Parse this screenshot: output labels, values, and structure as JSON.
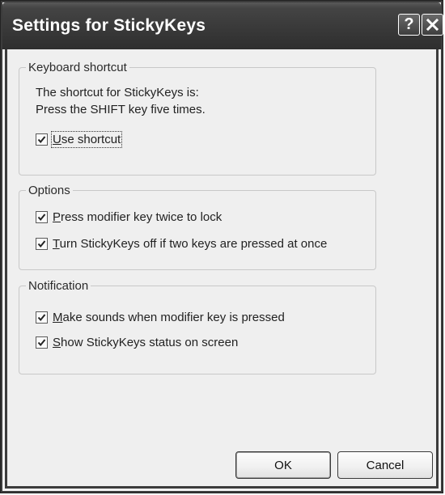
{
  "window": {
    "title": "Settings for StickyKeys",
    "help_glyph": "?",
    "close_glyph": "✕"
  },
  "groups": {
    "keyboard_shortcut": {
      "legend": "Keyboard shortcut",
      "line1": "The shortcut for StickyKeys is:",
      "line2": "Press the SHIFT key five times.",
      "use_shortcut": {
        "mnemonic": "U",
        "rest": "se shortcut",
        "checked": true
      }
    },
    "options": {
      "legend": "Options",
      "press_modifier": {
        "mnemonic": "P",
        "rest": "ress modifier key twice to lock",
        "checked": true
      },
      "turn_off": {
        "mnemonic": "T",
        "rest": "urn StickyKeys off if two keys are pressed at once",
        "checked": true
      }
    },
    "notification": {
      "legend": "Notification",
      "make_sounds": {
        "mnemonic": "M",
        "rest": "ake sounds when modifier key is pressed",
        "checked": true
      },
      "show_status": {
        "mnemonic": "S",
        "rest": "how StickyKeys status on screen",
        "checked": true
      }
    }
  },
  "buttons": {
    "ok": "OK",
    "cancel": "Cancel"
  }
}
